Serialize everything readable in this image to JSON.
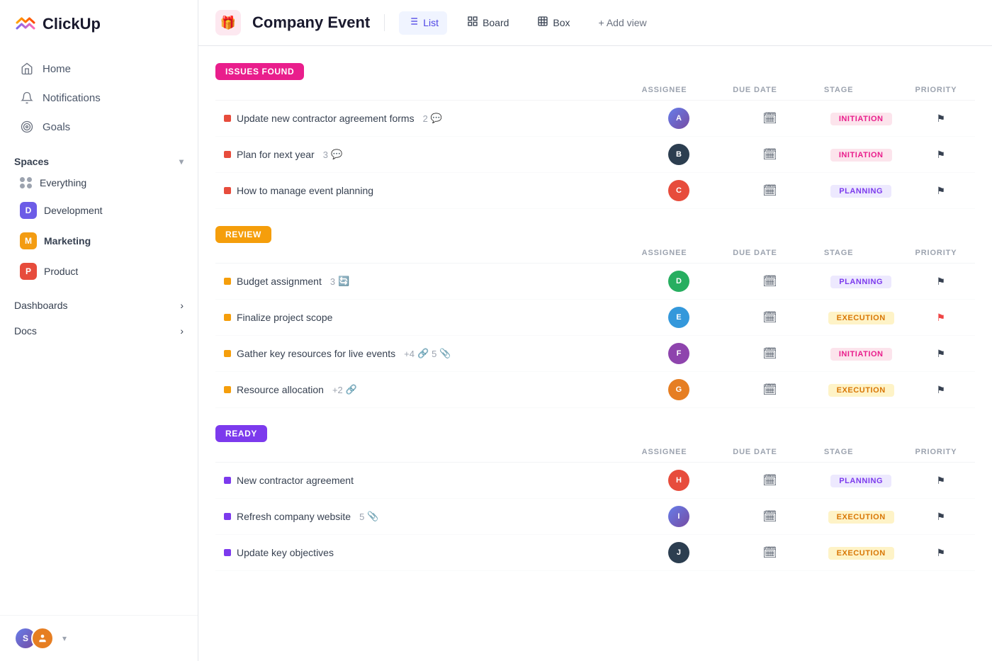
{
  "sidebar": {
    "logo": "ClickUp",
    "nav": [
      {
        "id": "home",
        "label": "Home",
        "icon": "🏠"
      },
      {
        "id": "notifications",
        "label": "Notifications",
        "icon": "🔔"
      },
      {
        "id": "goals",
        "label": "Goals",
        "icon": "🎯"
      }
    ],
    "spaces_label": "Spaces",
    "spaces": [
      {
        "id": "everything",
        "label": "Everything",
        "type": "dots"
      },
      {
        "id": "development",
        "label": "Development",
        "abbr": "D",
        "colorClass": "dot-d"
      },
      {
        "id": "marketing",
        "label": "Marketing",
        "abbr": "M",
        "colorClass": "dot-m"
      },
      {
        "id": "product",
        "label": "Product",
        "abbr": "P",
        "colorClass": "dot-p"
      }
    ],
    "sections": [
      {
        "id": "dashboards",
        "label": "Dashboards"
      },
      {
        "id": "docs",
        "label": "Docs"
      }
    ],
    "footer": {
      "user_initial": "S",
      "chevron": "▾"
    }
  },
  "topbar": {
    "event_title": "Company Event",
    "views": [
      {
        "id": "list",
        "label": "List",
        "icon": "≡",
        "active": true
      },
      {
        "id": "board",
        "label": "Board",
        "icon": "⊞",
        "active": false
      },
      {
        "id": "box",
        "label": "Box",
        "icon": "⊡",
        "active": false
      }
    ],
    "add_view_label": "+ Add view"
  },
  "groups": [
    {
      "id": "issues-found",
      "badge": "ISSUES FOUND",
      "badge_class": "badge-issues",
      "columns": [
        "ASSIGNEE",
        "DUE DATE",
        "STAGE",
        "PRIORITY"
      ],
      "tasks": [
        {
          "name": "Update new contractor agreement forms",
          "meta": "2 💬",
          "dot": "dot-red",
          "av": "av1",
          "av_text": "A",
          "stage": "INITIATION",
          "stage_class": "stage-initiation",
          "priority_high": false
        },
        {
          "name": "Plan for next year",
          "meta": "3 💬",
          "dot": "dot-red",
          "av": "av2",
          "av_text": "B",
          "stage": "INITIATION",
          "stage_class": "stage-initiation",
          "priority_high": false
        },
        {
          "name": "How to manage event planning",
          "meta": "",
          "dot": "dot-red",
          "av": "av3",
          "av_text": "C",
          "stage": "PLANNING",
          "stage_class": "stage-planning",
          "priority_high": false
        }
      ]
    },
    {
      "id": "review",
      "badge": "REVIEW",
      "badge_class": "badge-review",
      "columns": [
        "ASSIGNEE",
        "DUE DATE",
        "STAGE",
        "PRIORITY"
      ],
      "tasks": [
        {
          "name": "Budget assignment",
          "meta": "3 🔄",
          "dot": "dot-yellow",
          "av": "av4",
          "av_text": "D",
          "stage": "PLANNING",
          "stage_class": "stage-planning",
          "priority_high": false
        },
        {
          "name": "Finalize project scope",
          "meta": "",
          "dot": "dot-yellow",
          "av": "av5",
          "av_text": "E",
          "stage": "EXECUTION",
          "stage_class": "stage-execution",
          "priority_high": true
        },
        {
          "name": "Gather key resources for live events",
          "meta": "+4 🔗 5 📎",
          "dot": "dot-yellow",
          "av": "av6",
          "av_text": "F",
          "stage": "INITIATION",
          "stage_class": "stage-initiation",
          "priority_high": false
        },
        {
          "name": "Resource allocation",
          "meta": "+2 🔗",
          "dot": "dot-yellow",
          "av": "av7",
          "av_text": "G",
          "stage": "EXECUTION",
          "stage_class": "stage-execution",
          "priority_high": false
        }
      ]
    },
    {
      "id": "ready",
      "badge": "READY",
      "badge_class": "badge-ready",
      "columns": [
        "ASSIGNEE",
        "DUE DATE",
        "STAGE",
        "PRIORITY"
      ],
      "tasks": [
        {
          "name": "New contractor agreement",
          "meta": "",
          "dot": "dot-purple",
          "av": "av3",
          "av_text": "H",
          "stage": "PLANNING",
          "stage_class": "stage-planning",
          "priority_high": false
        },
        {
          "name": "Refresh company website",
          "meta": "5 📎",
          "dot": "dot-purple",
          "av": "av1",
          "av_text": "I",
          "stage": "EXECUTION",
          "stage_class": "stage-execution",
          "priority_high": false
        },
        {
          "name": "Update key objectives",
          "meta": "",
          "dot": "dot-purple",
          "av": "av2",
          "av_text": "J",
          "stage": "EXECUTION",
          "stage_class": "stage-execution",
          "priority_high": false
        }
      ]
    }
  ]
}
